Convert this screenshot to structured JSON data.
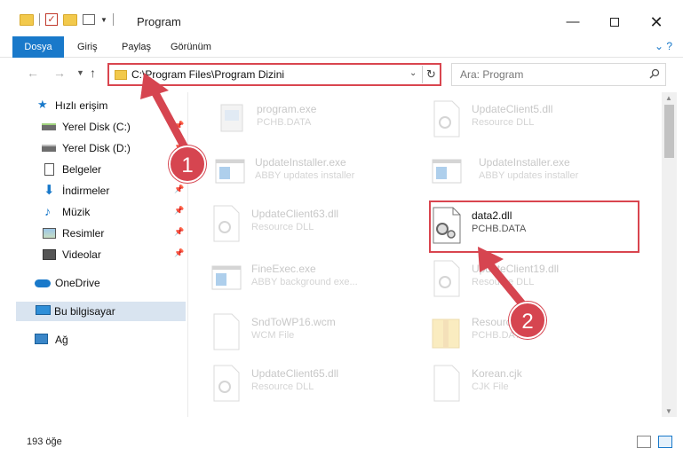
{
  "window": {
    "title": "Program",
    "minimize_glyph": "—",
    "close_glyph": "✕"
  },
  "ribbon": {
    "tabs": [
      "Dosya",
      "Giriş",
      "Paylaş",
      "Görünüm"
    ]
  },
  "address": {
    "path": "C:\\Program Files\\Program Dizini"
  },
  "search": {
    "placeholder": "Ara: Program"
  },
  "sidebar": {
    "items": [
      {
        "label": "Hızlı erişim",
        "icon": "star-icon"
      },
      {
        "label": "Yerel Disk (C:)",
        "icon": "drive-icon",
        "pinned": true
      },
      {
        "label": "Yerel Disk (D:)",
        "icon": "drive-icon",
        "pinned": true
      },
      {
        "label": "Belgeler",
        "icon": "document-icon"
      },
      {
        "label": "İndirmeler",
        "icon": "download-icon",
        "pinned": true
      },
      {
        "label": "Müzik",
        "icon": "music-icon",
        "pinned": true
      },
      {
        "label": "Resimler",
        "icon": "pictures-icon",
        "pinned": true
      },
      {
        "label": "Videolar",
        "icon": "video-icon",
        "pinned": true
      },
      {
        "label": "OneDrive",
        "icon": "cloud-icon"
      },
      {
        "label": "Bu bilgisayar",
        "icon": "computer-icon",
        "selected": true
      },
      {
        "label": "Ağ",
        "icon": "network-icon"
      }
    ]
  },
  "files": [
    {
      "name": "program.exe",
      "type": "PCHB.DATA",
      "icon": "exe-icon"
    },
    {
      "name": "UpdateClient5.dll",
      "type": "Resource DLL",
      "icon": "dll-gear-icon"
    },
    {
      "name": "UpdateInstaller.exe",
      "type": "ABBY updates installer",
      "icon": "app-window-icon"
    },
    {
      "name": "UpdateInstaller.exe",
      "type": "ABBY updates installer",
      "icon": "app-window-icon"
    },
    {
      "name": "UpdateClient63.dll",
      "type": "Resource DLL",
      "icon": "dll-gear-icon"
    },
    {
      "name": "data2.dll",
      "type": "PCHB.DATA",
      "icon": "dll-gear-icon"
    },
    {
      "name": "FineExec.exe",
      "type": "ABBY background exe...",
      "icon": "app-window-icon"
    },
    {
      "name": "UpdateClient19.dll",
      "type": "Resource DLL",
      "icon": "dll-gear-icon"
    },
    {
      "name": "SndToWP16.wcm",
      "type": "WCM File",
      "icon": "blank-file-icon"
    },
    {
      "name": "Resources",
      "type": "PCHB.DATA",
      "icon": "archive-icon"
    },
    {
      "name": "UpdateClient65.dll",
      "type": "Resource DLL",
      "icon": "dll-gear-icon"
    },
    {
      "name": "Korean.cjk",
      "type": "CJK File",
      "icon": "blank-file-icon"
    }
  ],
  "status": {
    "item_count": "193 öğe"
  },
  "annotations": {
    "step1": "1",
    "step2": "2"
  },
  "colors": {
    "accent": "#1979ca",
    "highlight": "#d9454f",
    "selected_bg": "#d9e4f0"
  }
}
